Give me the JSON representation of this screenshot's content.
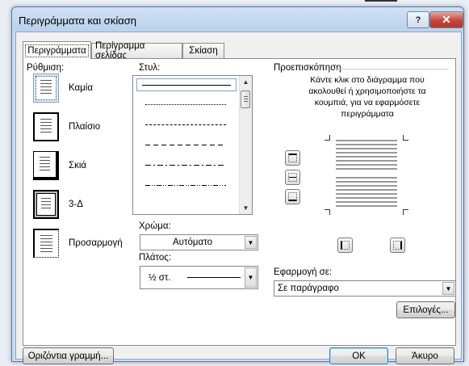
{
  "window": {
    "title": "Περιγράμματα και σκίαση"
  },
  "titlebar": {
    "help_glyph": "?",
    "close_glyph": "✕"
  },
  "tabs": [
    {
      "label": "Περιγράμματα"
    },
    {
      "label": "Περίγραμμα σελίδας"
    },
    {
      "label": "Σκίαση"
    }
  ],
  "setting": {
    "label": "Ρύθμιση:",
    "items": [
      {
        "label": "Καμία",
        "icon": "border-none-icon",
        "selected": true
      },
      {
        "label": "Πλαίσιο",
        "icon": "border-box-icon"
      },
      {
        "label": "Σκιά",
        "icon": "border-shadow-icon"
      },
      {
        "label": "3-Δ",
        "icon": "border-3d-icon"
      },
      {
        "label": "Προσαρμογή",
        "icon": "border-custom-icon"
      }
    ]
  },
  "style": {
    "label": "Στυλ:"
  },
  "color": {
    "label": "Χρώμα:",
    "value": "Αυτόματο"
  },
  "width": {
    "label": "Πλάτος:",
    "value": "½ στ."
  },
  "preview": {
    "label": "Προεπισκόπηση",
    "instructions": "Κάντε κλικ στο διάγραμμα που ακολουθεί ή χρησιμοποιήστε τα κουμπιά, για να εφαρμόσετε περιγράμματα"
  },
  "apply_to": {
    "label": "Εφαρμογή σε:",
    "value": "Σε παράγραφο"
  },
  "buttons": {
    "options": "Επιλογές...",
    "horizontal_line": "Οριζόντια γραμμή...",
    "ok": "OK",
    "cancel": "Άκυρο"
  }
}
